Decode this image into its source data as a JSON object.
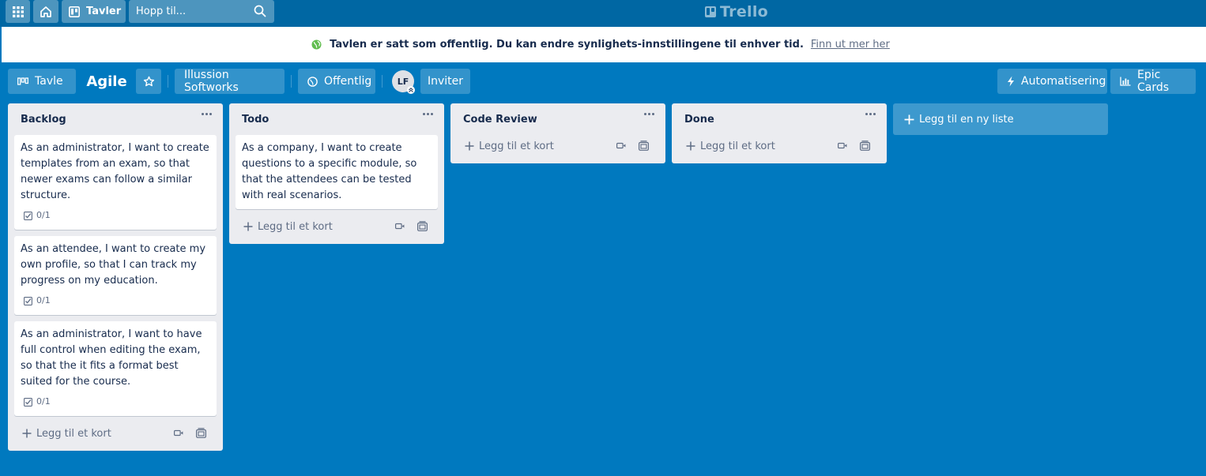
{
  "header": {
    "apps_icon": "grid-icon",
    "home_icon": "home-icon",
    "boards_label": "Tavler",
    "search_placeholder": "Hopp til...",
    "logo_text": "Trello"
  },
  "notice": {
    "text": "Tavlen er satt som offentlig. Du kan endre synlighets-innstillingene til enhver tid.",
    "link": "Finn ut mer her"
  },
  "board_bar": {
    "view_label": "Tavle",
    "board_title": "Agile",
    "workspace_label": "Illussion Softworks",
    "visibility_label": "Offentlig",
    "member_initials": "LF",
    "invite_label": "Inviter",
    "automation_label": "Automatisering",
    "powerup_label": "Epic Cards"
  },
  "lists": [
    {
      "title": "Backlog",
      "cards": [
        {
          "text": "As an administrator, I want to create templates from an exam, so that newer exams can follow a similar structure.",
          "checklist": "0/1"
        },
        {
          "text": "As an attendee, I want to create my own profile, so that I can track my progress on my education.",
          "checklist": "0/1"
        },
        {
          "text": "As an administrator, I want to have full control when editing the exam, so that the it fits a format best suited for the course.",
          "checklist": "0/1"
        }
      ],
      "add_label": "Legg til et kort"
    },
    {
      "title": "Todo",
      "cards": [
        {
          "text": "As a company, I want to create questions to a specific module, so that the attendees can be tested with real scenarios."
        }
      ],
      "add_label": "Legg til et kort"
    },
    {
      "title": "Code Review",
      "cards": [],
      "add_label": "Legg til et kort"
    },
    {
      "title": "Done",
      "cards": [],
      "add_label": "Legg til et kort"
    }
  ],
  "add_list_label": "Legg til en ny liste",
  "colors": {
    "board_bg": "#0079bf",
    "header_bg": "#0067a3",
    "list_bg": "#ebecf0",
    "public_globe": "#61bd4f"
  }
}
